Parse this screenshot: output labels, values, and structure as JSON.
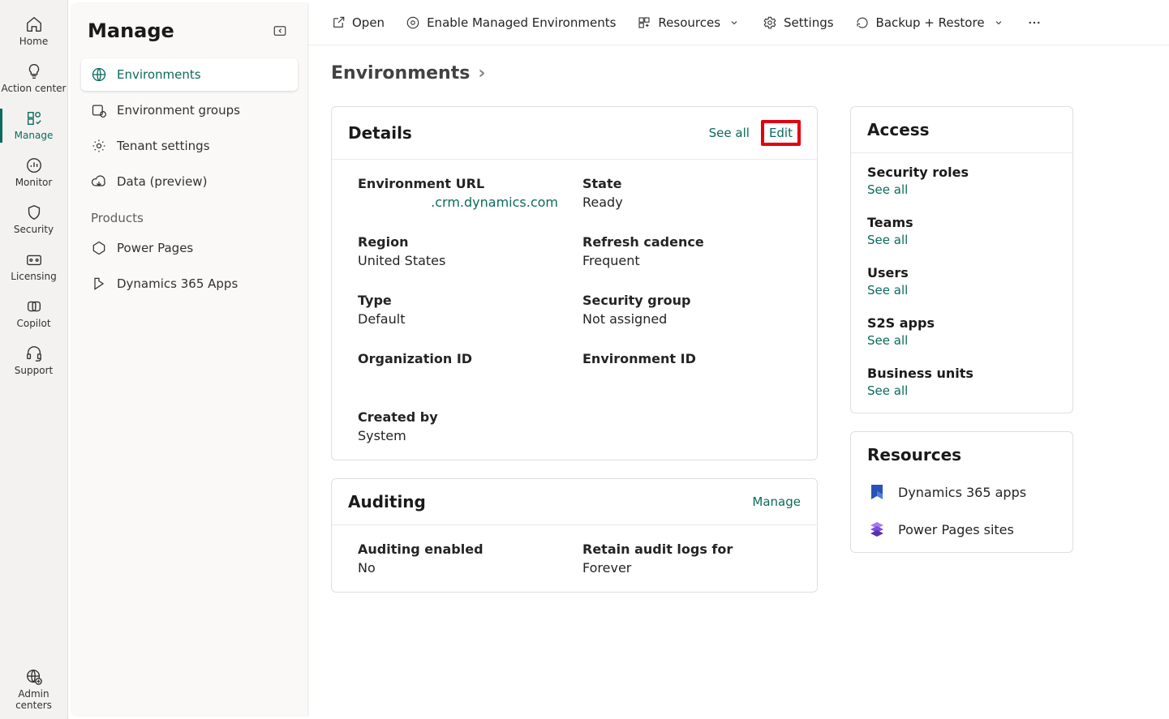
{
  "rail": [
    {
      "id": "home",
      "label": "Home",
      "active": false
    },
    {
      "id": "action-center",
      "label": "Action center",
      "active": false
    },
    {
      "id": "manage",
      "label": "Manage",
      "active": true
    },
    {
      "id": "monitor",
      "label": "Monitor",
      "active": false
    },
    {
      "id": "security",
      "label": "Security",
      "active": false
    },
    {
      "id": "licensing",
      "label": "Licensing",
      "active": false
    },
    {
      "id": "copilot",
      "label": "Copilot",
      "active": false
    },
    {
      "id": "support",
      "label": "Support",
      "active": false
    }
  ],
  "rail_bottom": {
    "id": "admin-centers",
    "label": "Admin centers"
  },
  "nav": {
    "title": "Manage",
    "items": [
      {
        "id": "environments",
        "label": "Environments",
        "selected": true
      },
      {
        "id": "environment-groups",
        "label": "Environment groups",
        "selected": false
      },
      {
        "id": "tenant-settings",
        "label": "Tenant settings",
        "selected": false
      },
      {
        "id": "data-preview",
        "label": "Data (preview)",
        "selected": false
      }
    ],
    "products_label": "Products",
    "products": [
      {
        "id": "power-pages",
        "label": "Power Pages"
      },
      {
        "id": "d365-apps",
        "label": "Dynamics 365 Apps"
      }
    ]
  },
  "toolbar": {
    "open": "Open",
    "enable_managed": "Enable Managed Environments",
    "resources": "Resources",
    "settings": "Settings",
    "backup_restore": "Backup + Restore"
  },
  "breadcrumb": {
    "environments": "Environments"
  },
  "details": {
    "title": "Details",
    "see_all": "See all",
    "edit": "Edit",
    "env_url_label": "Environment URL",
    "env_url_value": ".crm.dynamics.com",
    "state_label": "State",
    "state_value": "Ready",
    "region_label": "Region",
    "region_value": "United States",
    "refresh_label": "Refresh cadence",
    "refresh_value": "Frequent",
    "type_label": "Type",
    "type_value": "Default",
    "secgroup_label": "Security group",
    "secgroup_value": "Not assigned",
    "orgid_label": "Organization ID",
    "envid_label": "Environment ID",
    "created_label": "Created by",
    "created_value": "System"
  },
  "auditing": {
    "title": "Auditing",
    "manage": "Manage",
    "enabled_label": "Auditing enabled",
    "enabled_value": "No",
    "retain_label": "Retain audit logs for",
    "retain_value": "Forever"
  },
  "access": {
    "title": "Access",
    "see_all": "See all",
    "items": [
      {
        "label": "Security roles"
      },
      {
        "label": "Teams"
      },
      {
        "label": "Users"
      },
      {
        "label": "S2S apps"
      },
      {
        "label": "Business units"
      }
    ]
  },
  "resources": {
    "title": "Resources",
    "items": [
      {
        "id": "d365",
        "label": "Dynamics 365 apps"
      },
      {
        "id": "powerpages",
        "label": "Power Pages sites"
      }
    ]
  }
}
